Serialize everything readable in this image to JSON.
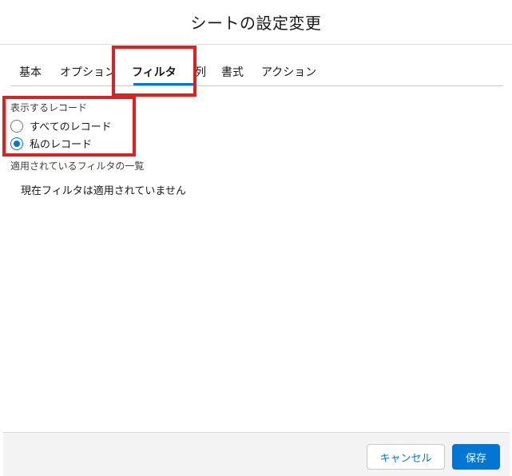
{
  "modal": {
    "title": "シートの設定変更"
  },
  "tabs": [
    {
      "label": "基本"
    },
    {
      "label": "オプション"
    },
    {
      "label": "フィルタ",
      "active": true
    },
    {
      "label": "列"
    },
    {
      "label": "書式"
    },
    {
      "label": "アクション"
    }
  ],
  "records": {
    "label": "表示するレコード",
    "options": [
      {
        "label": "すべてのレコード",
        "checked": false
      },
      {
        "label": "私のレコード",
        "checked": true
      }
    ]
  },
  "applied_filters": {
    "label": "適用されているフィルタの一覧",
    "empty_text": "現在フィルタは適用されていません"
  },
  "footer": {
    "cancel_label": "キャンセル",
    "save_label": "保存"
  },
  "colors": {
    "brand": "#0176d3",
    "highlight": "#e02020"
  }
}
